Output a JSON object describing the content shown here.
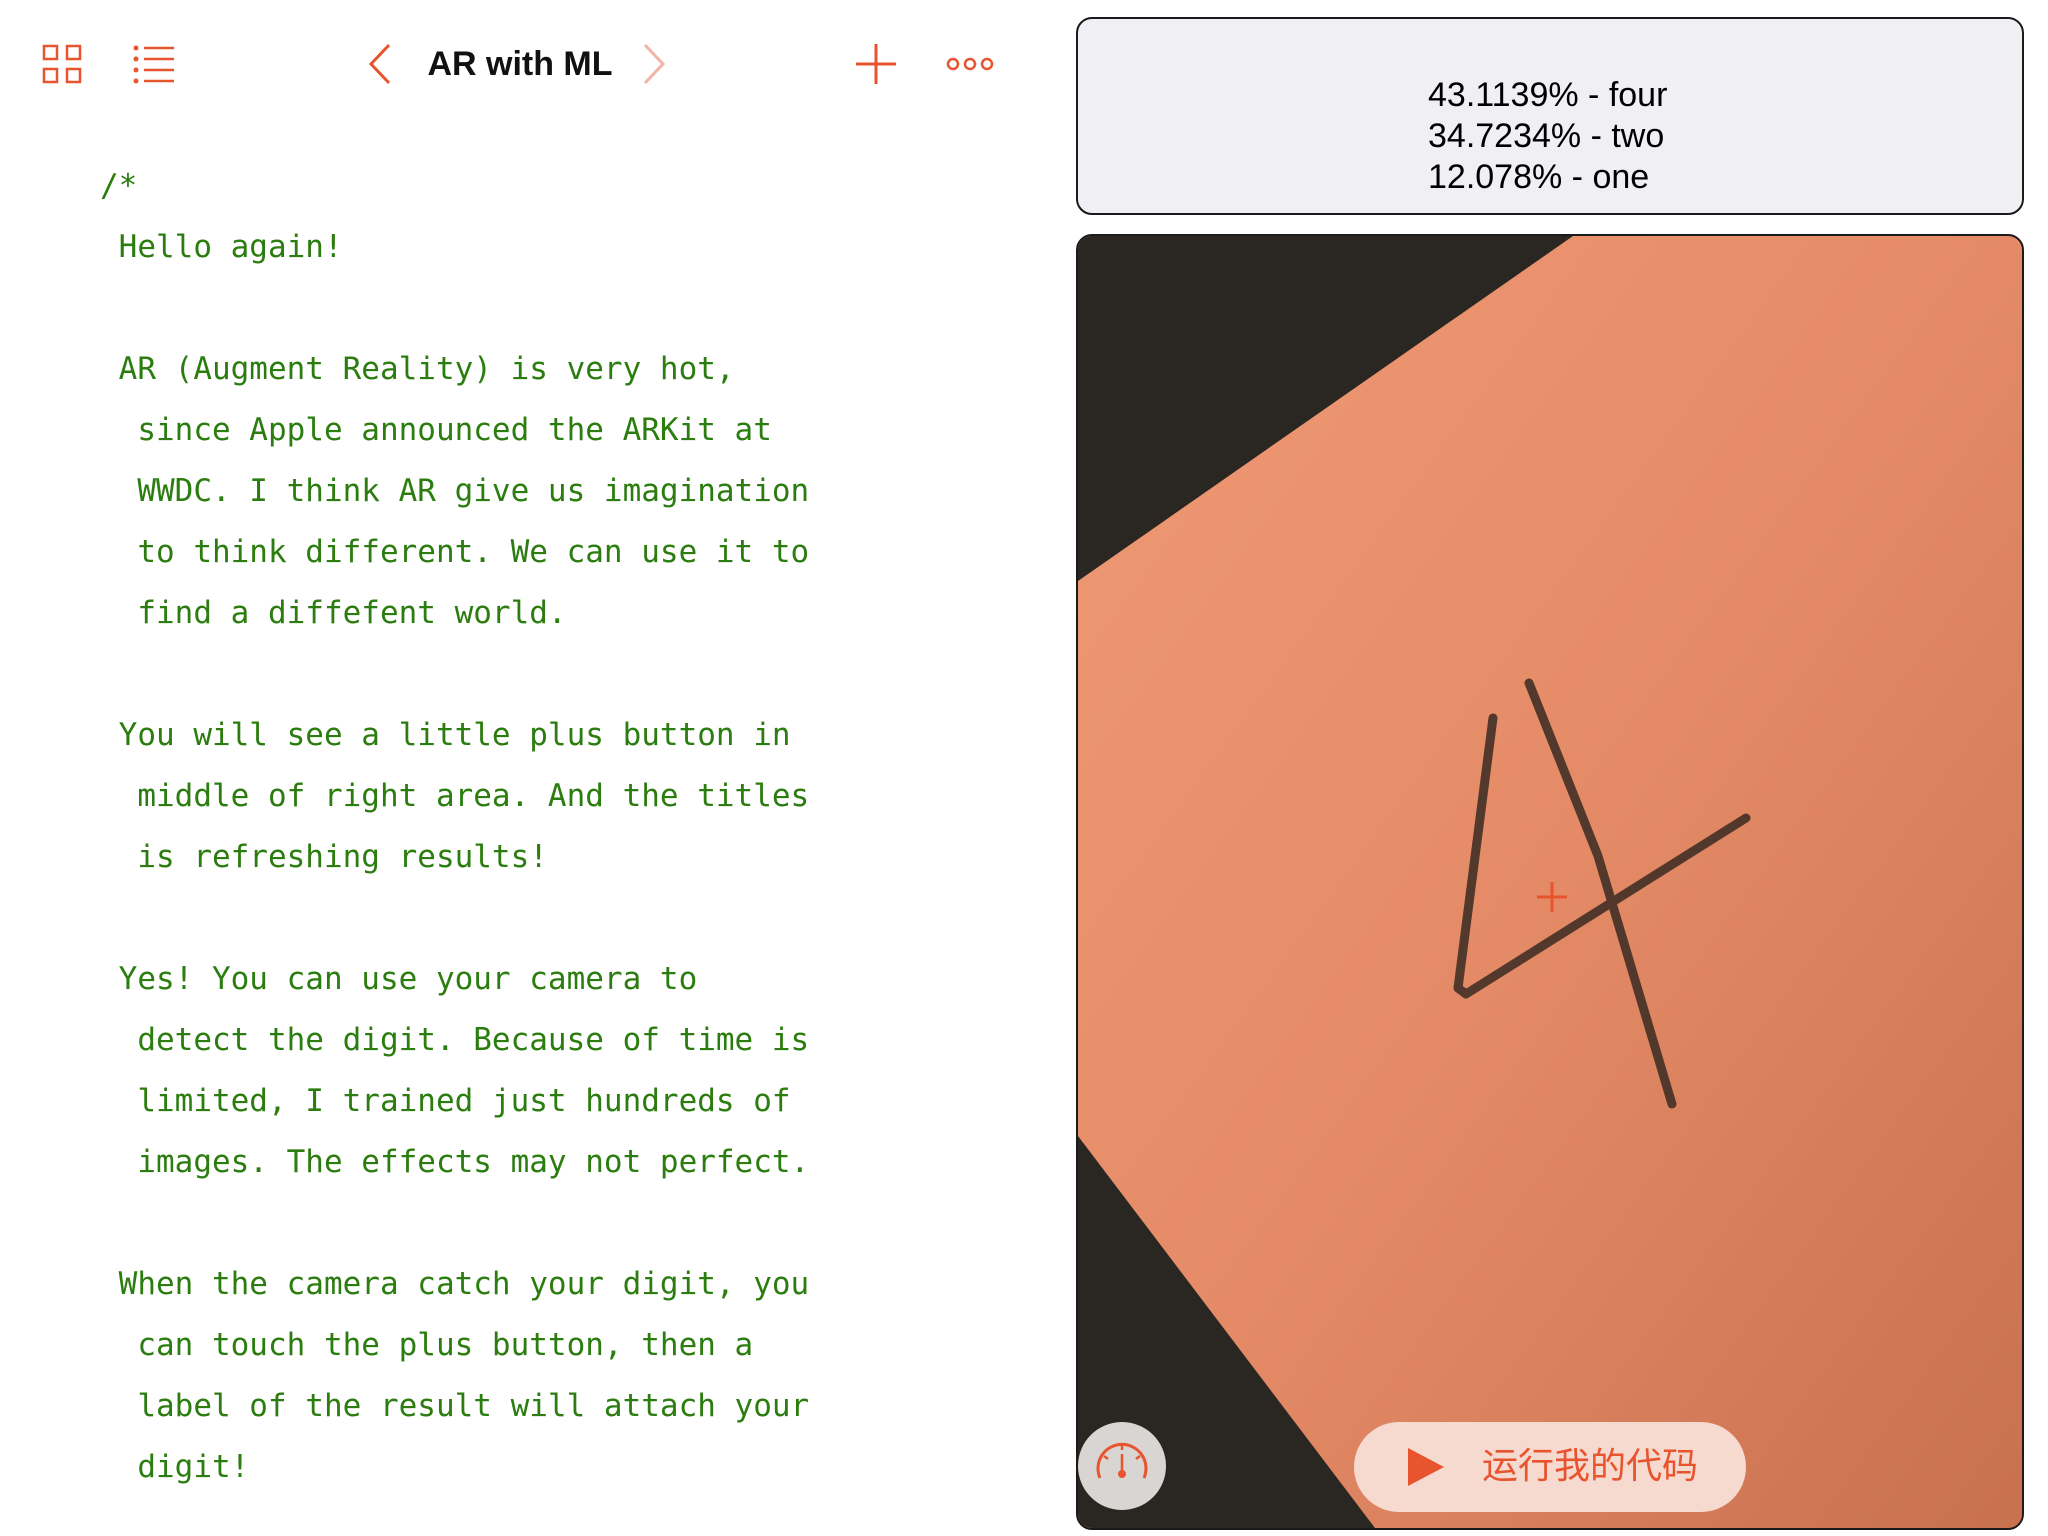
{
  "toolbar": {
    "title": "AR with ML",
    "accent": "#e8542e",
    "icons": [
      "grid-icon",
      "list-icon",
      "chevron-left-icon",
      "chevron-right-icon",
      "plus-icon",
      "more-icon"
    ]
  },
  "editor": {
    "text_color": "#2c7d10",
    "lines": [
      "/*",
      " Hello again!",
      "",
      " AR (Augment Reality) is very hot,",
      "  since Apple announced the ARKit at",
      "  WWDC. I think AR give us imagination",
      "  to think different. We can use it to",
      "  find a diffefent world.",
      "",
      " You will see a little plus button in",
      "  middle of right area. And the titles",
      "  is refreshing results!",
      "",
      " Yes! You can use your camera to",
      "  detect the digit. Because of time is",
      "  limited, I trained just hundreds of",
      "  images. The effects may not perfect.",
      "",
      " When the camera catch your digit, you",
      "  can touch the plus button, then a",
      "  label of the result will attach your",
      "  digit!"
    ]
  },
  "predictions": [
    "43.1139% - four",
    "34.7234% - two",
    "12.078% - one"
  ],
  "camera": {
    "paper_color": "#e8926d",
    "background_color": "#2a2723"
  },
  "run_button": {
    "label": "运行我的代码"
  }
}
